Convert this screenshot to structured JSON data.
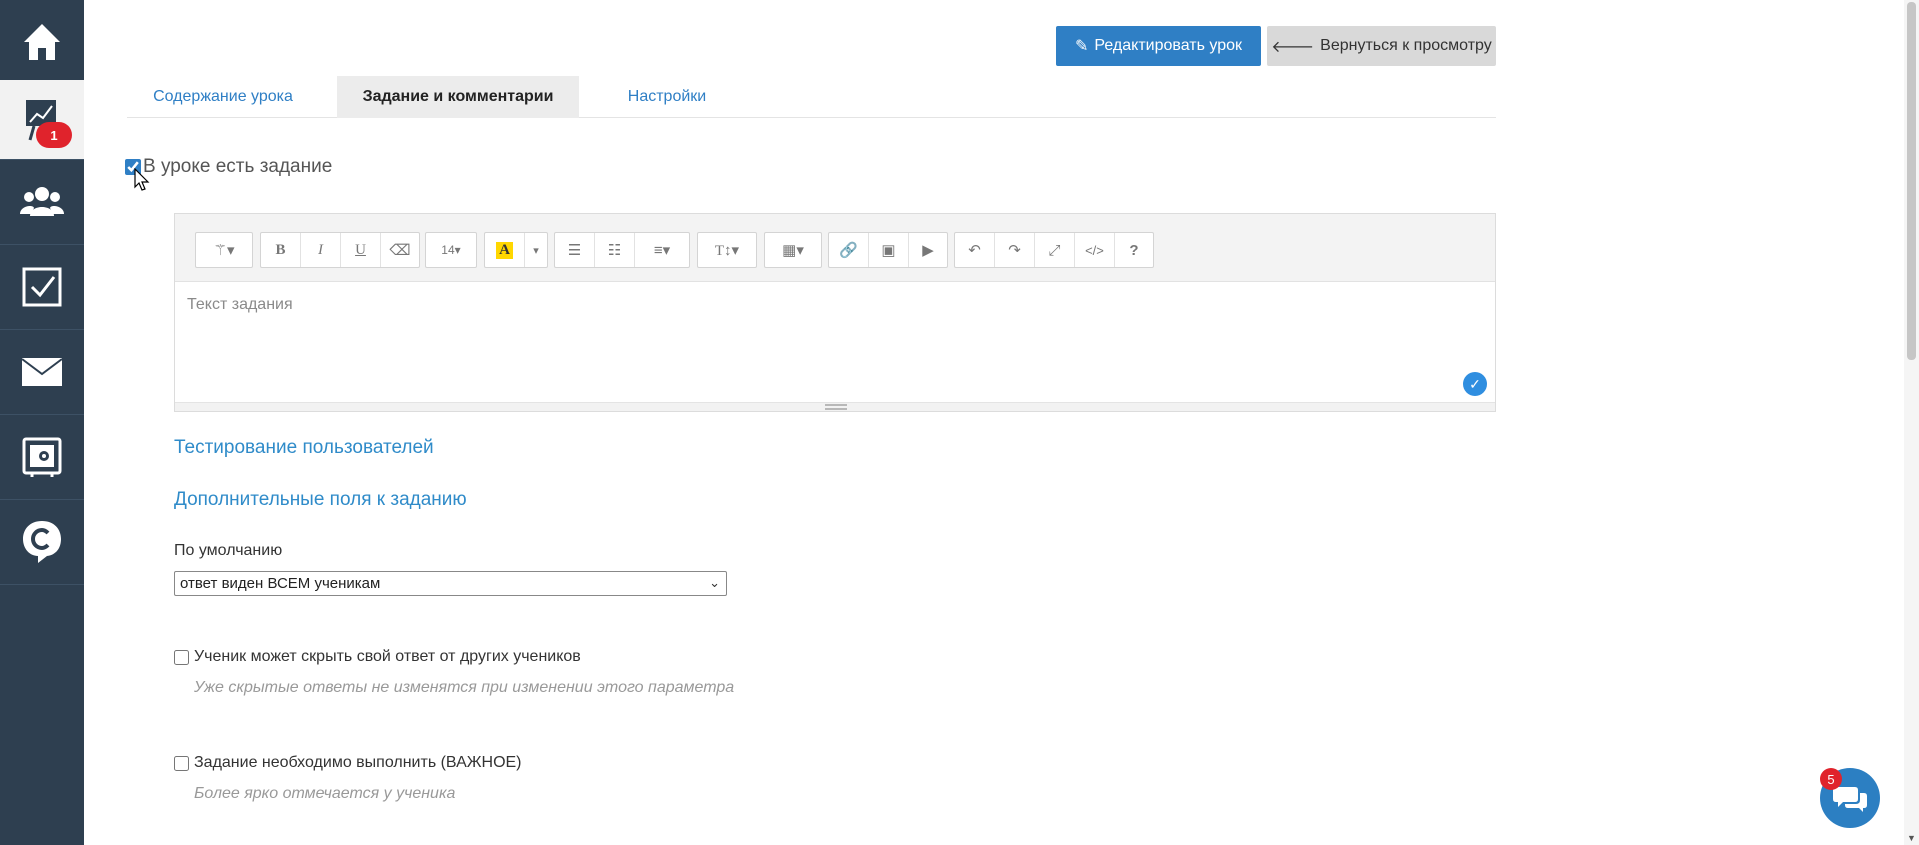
{
  "sidebar": {
    "items": [
      {
        "icon": "home-icon"
      },
      {
        "icon": "chart-board-icon",
        "badge": "1"
      },
      {
        "icon": "users-icon"
      },
      {
        "icon": "checkbox-icon"
      },
      {
        "icon": "mail-icon"
      },
      {
        "icon": "safe-icon"
      },
      {
        "icon": "chat-logo-icon"
      }
    ]
  },
  "header": {
    "edit_button": "Редактировать урок",
    "back_button": "Вернуться к просмотру"
  },
  "tabs": [
    {
      "label": "Содержание урока"
    },
    {
      "label": "Задание и комментарии",
      "active": true
    },
    {
      "label": "Настройки"
    }
  ],
  "task": {
    "has_task_label": "В уроке есть задание",
    "has_task_checked": true
  },
  "editor": {
    "font_size": "14",
    "placeholder": "Текст задания",
    "toolbar": [
      "magic-icon",
      "bold-icon",
      "italic-icon",
      "underline-icon",
      "eraser-icon",
      "font-size-dropdown",
      "text-color-icon",
      "color-dropdown-icon",
      "unordered-list-icon",
      "ordered-list-icon",
      "align-icon",
      "text-height-icon",
      "table-icon",
      "link-icon",
      "image-icon",
      "video-icon",
      "undo-icon",
      "redo-icon",
      "fullscreen-icon",
      "code-icon",
      "help-icon"
    ]
  },
  "sections": {
    "testing_link": "Тестирование пользователей",
    "extra_fields_link": "Дополнительные поля к заданию"
  },
  "visibility": {
    "label": "По умолчанию",
    "selected": "ответ виден ВСЕМ ученикам"
  },
  "options": {
    "hide_answer_label": "Ученик может скрыть свой ответ от других учеников",
    "hide_answer_hint": "Уже скрытые ответы не изменятся при изменении этого параметра",
    "important_label": "Задание необходимо выполнить (ВАЖНОЕ)",
    "important_hint": "Более ярко отмечается у ученика"
  },
  "chat": {
    "badge": "5"
  },
  "colors": {
    "sidebar": "#2e3f50",
    "accent": "#2f7fc5",
    "badge": "#e0232c"
  }
}
